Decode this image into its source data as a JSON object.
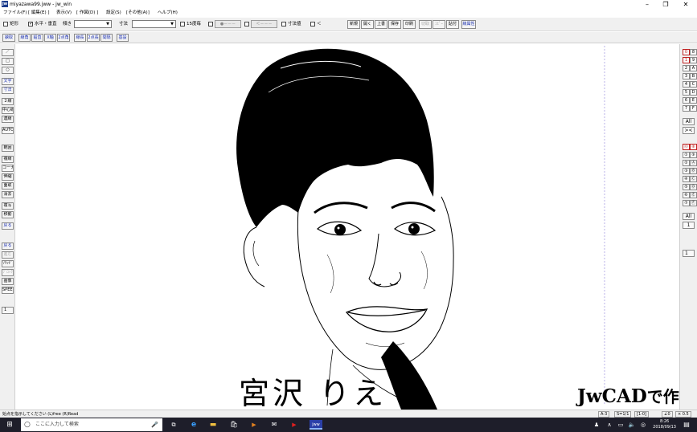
{
  "window": {
    "title": "miyazawa99.jww - jw_win",
    "app_icon": "jw",
    "minimize": "–",
    "maximize": "❐",
    "close": "✕"
  },
  "menu": [
    "ファイル(F)",
    "[ 編集(E) ]",
    "表示(V)",
    "[ 作図(D) ]",
    "設定(S)",
    "[その他(A)]",
    "ヘルプ(H)"
  ],
  "toolbar1": {
    "rect_label": "矩形",
    "horiz_vert_label": "水平・垂直",
    "tilt_label": "傾き",
    "dim_label": "寸法",
    "deg15_label": "15度毎",
    "circle_box": "●－－－",
    "arrow_box": "＜－－－",
    "dim_value_label": "寸法値",
    "lt_label": "＜",
    "buttons": [
      {
        "label": "新規",
        "state": "normal"
      },
      {
        "label": "開く",
        "state": "normal"
      },
      {
        "label": "上書",
        "state": "normal"
      },
      {
        "label": "保存",
        "state": "normal"
      },
      {
        "label": "印刷",
        "state": "normal"
      },
      {
        "label": "切取",
        "state": "disabled"
      },
      {
        "label": "ｺﾋﾟｰ",
        "state": "disabled"
      },
      {
        "label": "貼付",
        "state": "normal"
      },
      {
        "label": "線属性",
        "state": "highlight"
      }
    ]
  },
  "toolbar2": [
    "鋏取",
    "線角",
    "鉛直",
    "X軸",
    "2点角",
    "線長",
    "2点長",
    "間隔",
    "基設"
  ],
  "left_palette": [
    {
      "label": "／",
      "state": "normal"
    },
    {
      "label": "□",
      "state": "normal"
    },
    {
      "label": "○",
      "state": "normal"
    },
    {
      "label": "文字",
      "state": "blue"
    },
    {
      "label": "寸法",
      "state": "blue"
    },
    {
      "label": "２線",
      "state": "normal"
    },
    {
      "label": "中心線",
      "state": "normal"
    },
    {
      "label": "連線",
      "state": "normal"
    },
    {
      "label": "AUTO",
      "state": "normal"
    },
    {
      "label": "範囲",
      "state": "normal"
    },
    {
      "label": "複線",
      "state": "normal"
    },
    {
      "label": "コーナー",
      "state": "normal"
    },
    {
      "label": "伸縮",
      "state": "normal"
    },
    {
      "label": "面取",
      "state": "normal"
    },
    {
      "label": "消去",
      "state": "normal"
    },
    {
      "label": "複写",
      "state": "normal"
    },
    {
      "label": "移動",
      "state": "normal"
    },
    {
      "label": "戻る",
      "state": "blue"
    },
    {
      "label": "戻る",
      "state": "blue"
    },
    {
      "label": "進む",
      "state": "disabled"
    },
    {
      "label": "ｿﾘｯﾄﾞ",
      "state": "normal"
    },
    {
      "label": "ﾌﾞﾛｯｸ",
      "state": "disabled"
    },
    {
      "label": "画像",
      "state": "normal"
    },
    {
      "label": "SPEED",
      "state": "normal"
    },
    {
      "label": "1",
      "state": "normal"
    }
  ],
  "right_palette": {
    "layer_top": [
      [
        "0",
        "8"
      ],
      [
        "1",
        "9"
      ],
      [
        "2",
        "A"
      ],
      [
        "3",
        "B"
      ],
      [
        "4",
        "C"
      ],
      [
        "5",
        "D"
      ],
      [
        "6",
        "E"
      ],
      [
        "7",
        "F"
      ]
    ],
    "all_top": "All",
    "x_top": "><",
    "layer_group": [
      [
        "⓪",
        "⑧"
      ],
      [
        "①",
        "⑨"
      ],
      [
        "②",
        "Ⓐ"
      ],
      [
        "③",
        "Ⓑ"
      ],
      [
        "④",
        "Ⓒ"
      ],
      [
        "⑤",
        "Ⓓ"
      ],
      [
        "⑥",
        "Ⓔ"
      ],
      [
        "⑦",
        "Ⓕ"
      ]
    ],
    "all_group": "All",
    "group_num": "1",
    "scale_box": "1"
  },
  "canvas": {
    "caption_left": "宮沢 りえ",
    "caption_right_latin": "JwCAD",
    "caption_right_jp": "で作図"
  },
  "status": {
    "message": "始点を指示してください (L)free (R)Read",
    "layer": "A-3",
    "scale": "S=1/1",
    "group": "[1-0]",
    "angle": "∠0",
    "zoom": "× 0.5"
  },
  "taskbar": {
    "search_placeholder": "ここに入力して検索",
    "time": "8:26",
    "date": "2018/09/13",
    "mic_icon": "🎤",
    "edge_label": "e",
    "apps": [
      "⊞",
      "e",
      "▬",
      "🛍",
      "▶",
      "✉",
      "▶",
      "jww"
    ]
  }
}
